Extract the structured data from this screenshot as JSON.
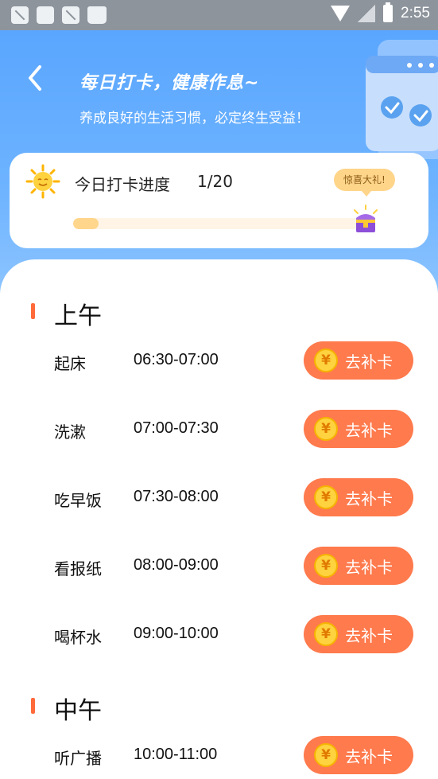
{
  "status_bar": {
    "time": "2:55"
  },
  "header": {
    "title": "每日打卡，健康作息~",
    "subtitle": "养成良好的生活习惯，必定终生受益！"
  },
  "progress": {
    "label": "今日打卡进度",
    "count_text": "1/20",
    "completed": 1,
    "total": 20,
    "gift_label": "惊喜大礼!"
  },
  "sections": [
    {
      "title": "上午",
      "items": [
        {
          "name": "起床",
          "time": "06:30-07:00",
          "action": "去补卡"
        },
        {
          "name": "洗漱",
          "time": "07:00-07:30",
          "action": "去补卡"
        },
        {
          "name": "吃早饭",
          "time": "07:30-08:00",
          "action": "去补卡"
        },
        {
          "name": "看报纸",
          "time": "08:00-09:00",
          "action": "去补卡"
        },
        {
          "name": "喝杯水",
          "time": "09:00-10:00",
          "action": "去补卡"
        }
      ]
    },
    {
      "title": "中午",
      "items": [
        {
          "name": "听广播",
          "time": "10:00-11:00",
          "action": "去补卡"
        }
      ]
    }
  ],
  "colors": {
    "accent": "#ff7a4d",
    "hero_blue": "#5aa6ff",
    "coin": "#ffd23f"
  }
}
